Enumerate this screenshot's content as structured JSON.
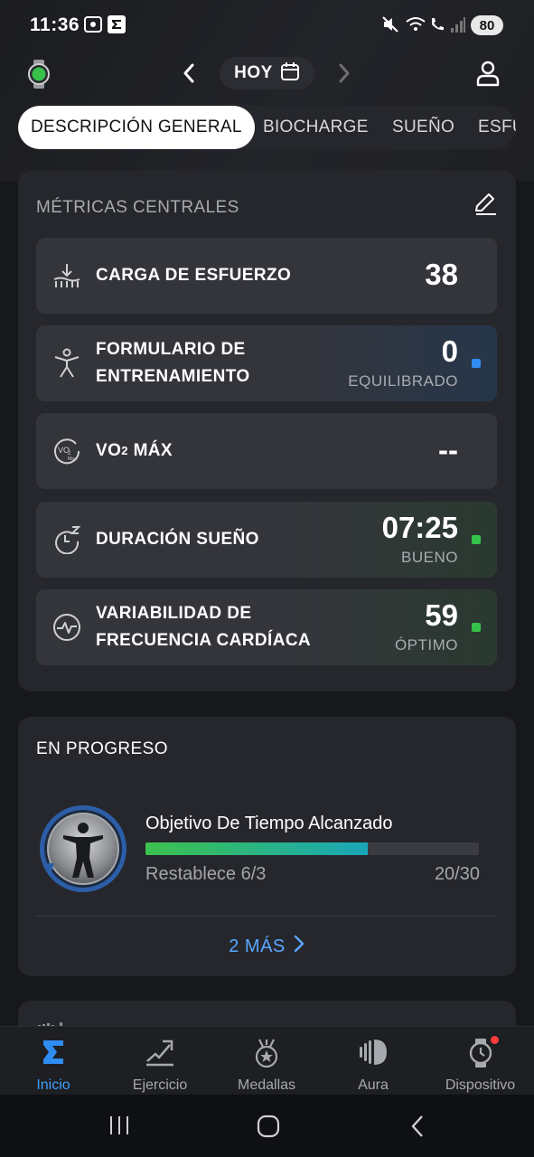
{
  "status_bar": {
    "time": "11:36",
    "battery": "80"
  },
  "header": {
    "date_label": "HOY"
  },
  "tabs": [
    {
      "label": "DESCRIPCIÓN GENERAL",
      "active": true
    },
    {
      "label": "BIOCHARGE",
      "active": false
    },
    {
      "label": "SUEÑO",
      "active": false
    },
    {
      "label": "ESFU",
      "active": false
    }
  ],
  "core_metrics": {
    "title": "MÉTRICAS CENTRALES",
    "items": [
      {
        "label": "CARGA DE ESFUERZO",
        "value": "38",
        "status": "",
        "icon": "effort-load-icon"
      },
      {
        "label_line1": "FORMULARIO DE",
        "label_line2": "ENTRENAMIENTO",
        "value": "0",
        "status": "EQUILIBRADO",
        "status_color": "#2f8cf0",
        "icon": "training-form-icon"
      },
      {
        "label_main": "VO",
        "label_sub": "2",
        "label_rest": " MÁX",
        "value": "--",
        "status": "",
        "icon": "vo2max-icon"
      },
      {
        "label": "DURACIÓN SUEÑO",
        "value": "07:25",
        "status": "BUENO",
        "status_color": "#35c24a",
        "icon": "sleep-duration-icon"
      },
      {
        "label_line1": "VARIABILIDAD DE",
        "label_line2": "FRECUENCIA CARDÍACA",
        "value": "59",
        "status": "ÓPTIMO",
        "status_color": "#35c24a",
        "icon": "hrv-icon"
      }
    ]
  },
  "in_progress": {
    "title": "EN PROGRESO",
    "goal_title": "Objetivo De Tiempo Alcanzado",
    "reset_text": "Restablece 6/3",
    "count_text": "20/30",
    "progress_fraction": 0.667,
    "more_label": "2 MÁS"
  },
  "bottom_nav": [
    {
      "label": "Inicio",
      "icon": "home-sigma-icon",
      "active": true
    },
    {
      "label": "Ejercicio",
      "icon": "exercise-icon",
      "active": false
    },
    {
      "label": "Medallas",
      "icon": "medal-icon",
      "active": false
    },
    {
      "label": "Aura",
      "icon": "aura-icon",
      "active": false
    },
    {
      "label": "Dispositivo",
      "icon": "watch-icon",
      "active": false
    }
  ],
  "colors": {
    "accent": "#3ea0ff",
    "good": "#35c24a",
    "balanced": "#2f8cf0"
  }
}
